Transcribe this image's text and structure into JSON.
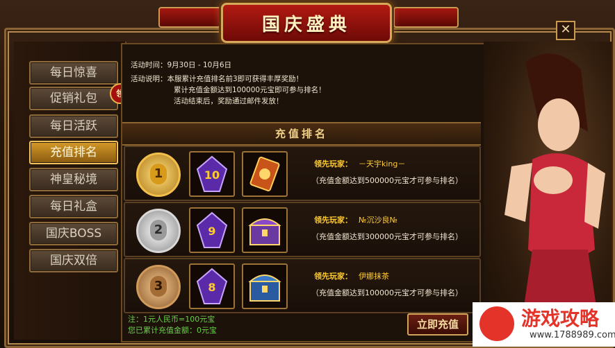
{
  "window": {
    "title": "国庆盛典",
    "close_label": "✕"
  },
  "sidebar": {
    "items": [
      {
        "label": "每日惊喜",
        "active": false
      },
      {
        "label": "促销礼包",
        "active": false
      },
      {
        "label": "每日活跃",
        "active": false
      },
      {
        "label": "充值排名",
        "active": true
      },
      {
        "label": "神皇秘境",
        "active": false
      },
      {
        "label": "每日礼盒",
        "active": false
      },
      {
        "label": "国庆BOSS",
        "active": false
      },
      {
        "label": "国庆双倍",
        "active": false
      }
    ],
    "badge": "领"
  },
  "info": {
    "time": "活动时间：9月30日 - 10月6日",
    "desc_line1": "活动说明：本服累计充值排名前3即可获得丰厚奖励！",
    "desc_line2": "累计充值金额达到100000元宝即可参与排名！",
    "desc_line3": "活动结束后，奖励通过邮件发放！"
  },
  "ranking": {
    "header": "充值排名",
    "rows": [
      {
        "rank": "1",
        "gem_number": "10",
        "leader_label": "领先玩家：",
        "leader_name": "－天宇king－",
        "condition": "（充值金额达到500000元宝才可参与排名）"
      },
      {
        "rank": "2",
        "gem_number": "9",
        "leader_label": "领先玩家：",
        "leader_name": "№沉沙良№",
        "condition": "（充值金额达到300000元宝才可参与排名）"
      },
      {
        "rank": "3",
        "gem_number": "8",
        "leader_label": "领先玩家：",
        "leader_name": "伊娜抹茶",
        "condition": "（充值金额达到100000元宝才可参与排名）"
      }
    ]
  },
  "footer": {
    "note1": "注：1元人民币=100元宝",
    "note2": "您已累计充值金额：0元宝",
    "recharge_button": "立即充值"
  },
  "watermark": {
    "text": "游戏攻略",
    "url": "www.1788989.com"
  }
}
